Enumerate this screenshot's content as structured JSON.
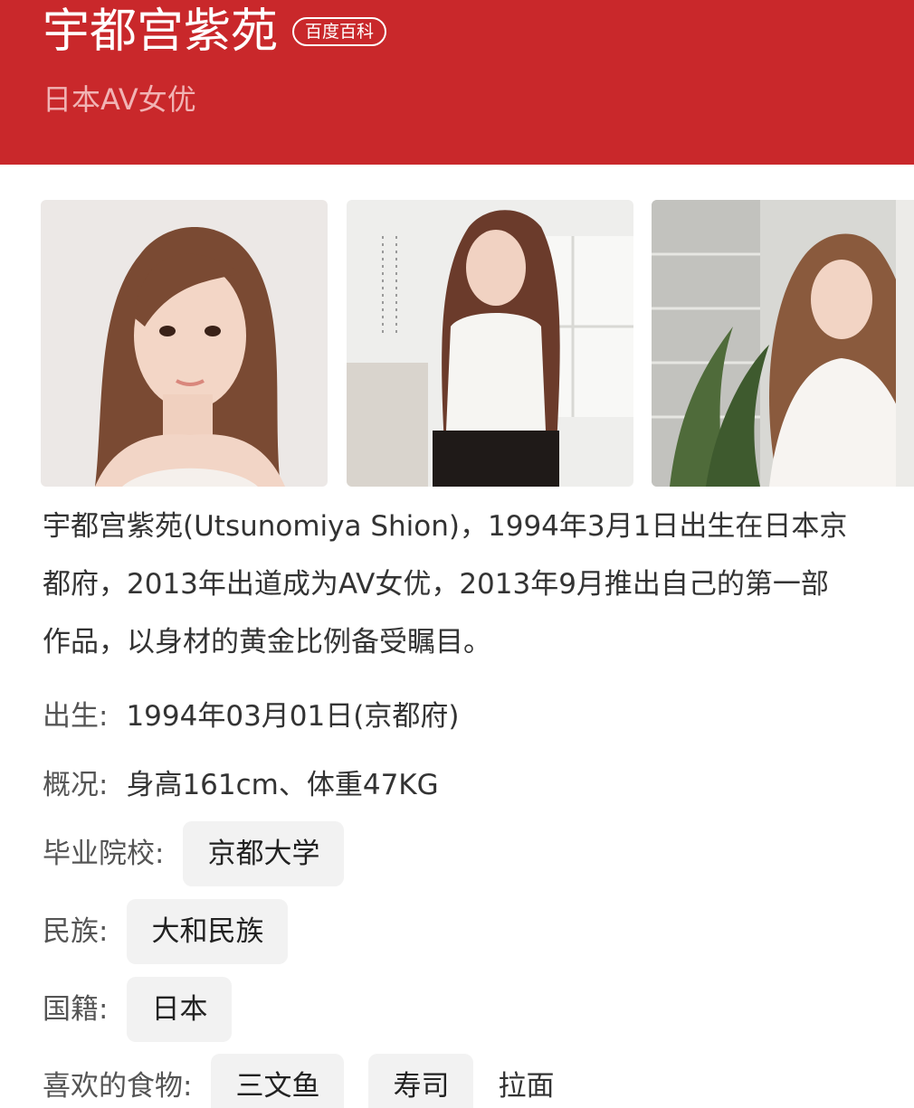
{
  "header": {
    "title": "宇都宫紫苑",
    "badge": "百度百科",
    "subtitle": "日本AV女优",
    "bg_color": "#c9282b"
  },
  "gallery": {
    "photos": [
      {
        "name": "portrait-photo",
        "alt": ""
      },
      {
        "name": "white-top-photo",
        "alt": ""
      },
      {
        "name": "white-blouse-plants-photo",
        "alt": ""
      }
    ]
  },
  "summary": {
    "line1": "宇都宫紫苑(Utsunomiya Shion)，1994年3月1日出生在日本京",
    "line2": "都府，2013年出道成为AV女优，2013年9月推出自己的第一部",
    "line3": "作品，以身材的黄金比例备受瞩目。"
  },
  "info": {
    "birth": {
      "label": "出生:",
      "value": "1994年03月01日(京都府)"
    },
    "overview": {
      "label": "概况:",
      "value": "身高161cm、体重47KG"
    },
    "school": {
      "label": "毕业院校:",
      "tags": [
        "京都大学"
      ]
    },
    "ethnicity": {
      "label": "民族:",
      "tags": [
        "大和民族"
      ]
    },
    "nationality": {
      "label": "国籍:",
      "tags": [
        "日本"
      ]
    },
    "food": {
      "label": "喜欢的食物:",
      "tags": [
        "三文鱼",
        "寿司"
      ],
      "extra": "拉面"
    }
  }
}
